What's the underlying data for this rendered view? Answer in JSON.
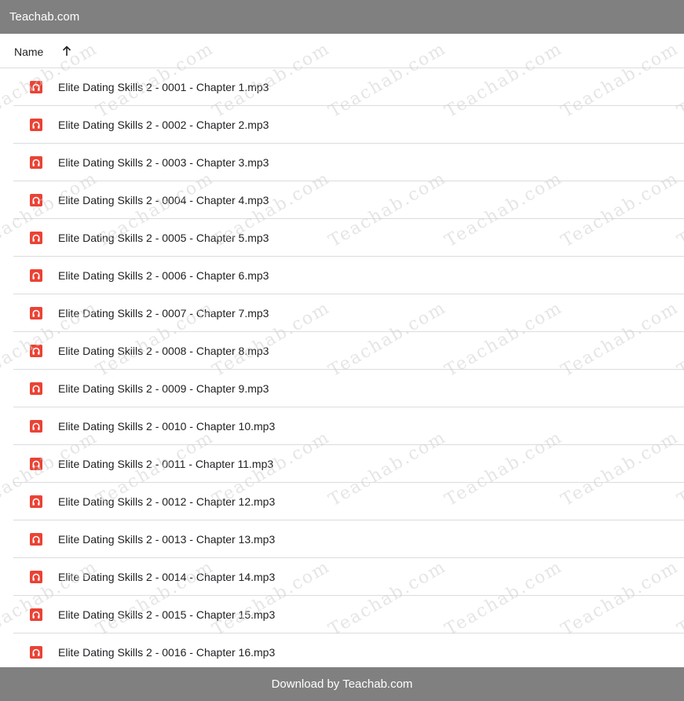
{
  "top_bar": {
    "title": "Teachab.com"
  },
  "header": {
    "name_label": "Name",
    "sort_icon": "arrow-up-icon"
  },
  "files": [
    {
      "name": "Elite Dating Skills 2 - 0001 - Chapter 1.mp3",
      "icon": "audio-file-icon"
    },
    {
      "name": "Elite Dating Skills 2 - 0002 - Chapter 2.mp3",
      "icon": "audio-file-icon"
    },
    {
      "name": "Elite Dating Skills 2 - 0003 - Chapter 3.mp3",
      "icon": "audio-file-icon"
    },
    {
      "name": "Elite Dating Skills 2 - 0004 - Chapter 4.mp3",
      "icon": "audio-file-icon"
    },
    {
      "name": "Elite Dating Skills 2 - 0005 - Chapter 5.mp3",
      "icon": "audio-file-icon"
    },
    {
      "name": "Elite Dating Skills 2 - 0006 - Chapter 6.mp3",
      "icon": "audio-file-icon"
    },
    {
      "name": "Elite Dating Skills 2 - 0007 - Chapter 7.mp3",
      "icon": "audio-file-icon"
    },
    {
      "name": "Elite Dating Skills 2 - 0008 - Chapter 8.mp3",
      "icon": "audio-file-icon"
    },
    {
      "name": "Elite Dating Skills 2 - 0009 - Chapter 9.mp3",
      "icon": "audio-file-icon"
    },
    {
      "name": "Elite Dating Skills 2 - 0010 - Chapter 10.mp3",
      "icon": "audio-file-icon"
    },
    {
      "name": "Elite Dating Skills 2 - 0011 - Chapter 11.mp3",
      "icon": "audio-file-icon"
    },
    {
      "name": "Elite Dating Skills 2 - 0012 - Chapter 12.mp3",
      "icon": "audio-file-icon"
    },
    {
      "name": "Elite Dating Skills 2 - 0013 - Chapter 13.mp3",
      "icon": "audio-file-icon"
    },
    {
      "name": "Elite Dating Skills 2 - 0014 - Chapter 14.mp3",
      "icon": "audio-file-icon"
    },
    {
      "name": "Elite Dating Skills 2 - 0015 - Chapter 15.mp3",
      "icon": "audio-file-icon"
    },
    {
      "name": "Elite Dating Skills 2 - 0016 - Chapter 16.mp3",
      "icon": "audio-file-icon"
    }
  ],
  "watermark": {
    "text": "Teachab.com"
  },
  "bottom_bar": {
    "text": "Download by Teachab.com"
  },
  "colors": {
    "bar_bg": "#808080",
    "icon_red": "#ea4335",
    "divider": "#dadce0",
    "text": "#202124"
  }
}
